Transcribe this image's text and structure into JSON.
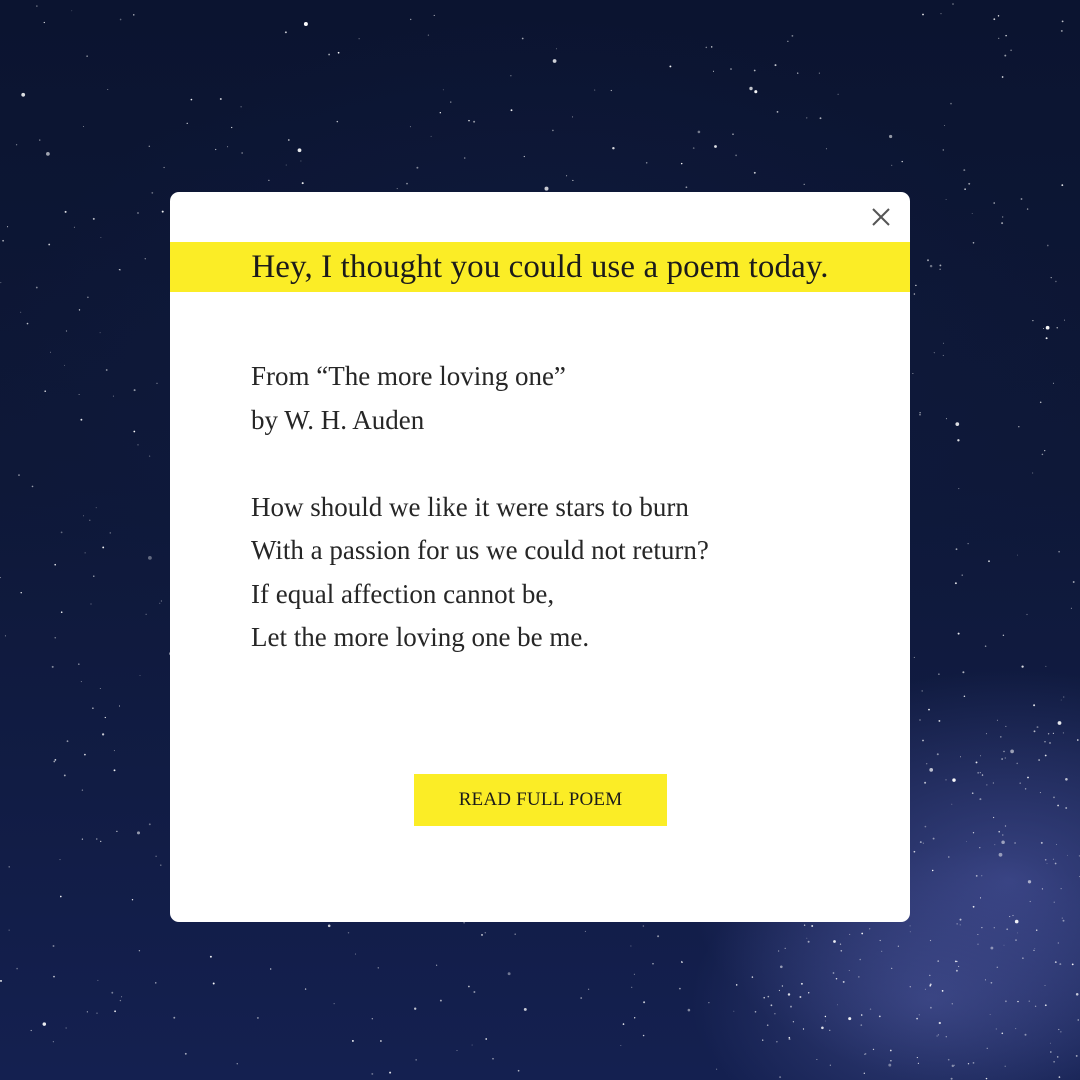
{
  "colors": {
    "accent_yellow": "#fbed26",
    "card_background": "#ffffff",
    "night_sky": "#0e1838",
    "text": "#262626"
  },
  "dialog": {
    "close_icon": "close-icon",
    "banner_text": "Hey, I thought you could use a poem today.",
    "source": {
      "title_line": "From “The more loving one”",
      "author_line": "by W. H. Auden"
    },
    "poem_lines": [
      "How should we like it were stars to burn",
      "With a passion for us we could not return?",
      "If equal affection cannot be,",
      "Let the more loving one be me."
    ],
    "cta_label": "READ FULL POEM"
  }
}
